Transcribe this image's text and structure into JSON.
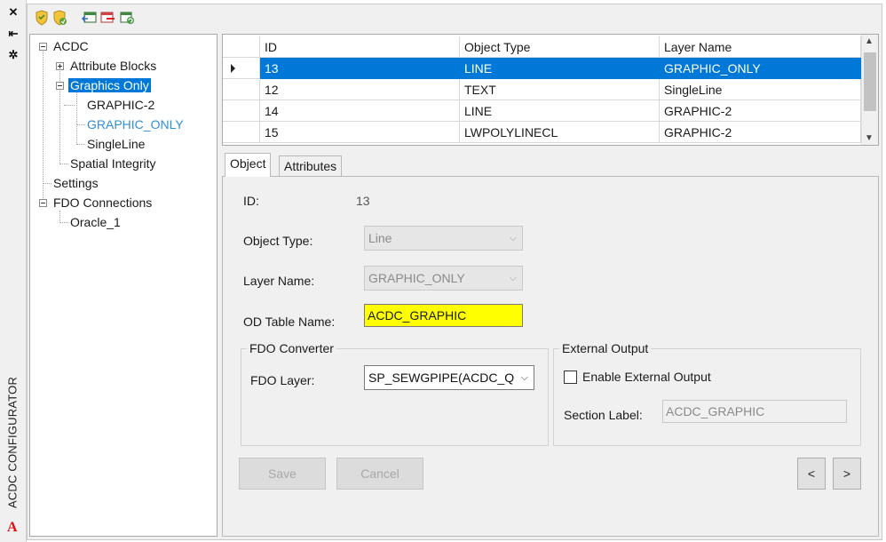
{
  "strip": {
    "title": "ACDC CONFIGURATOR",
    "icons": [
      "close-icon",
      "pin-icon",
      "settings-icon"
    ],
    "logo": "A"
  },
  "toolbar": {
    "icons": [
      "shield-icon",
      "shield-refresh-icon",
      "table-export-icon",
      "table-delete-icon",
      "refresh-icon"
    ]
  },
  "tree": {
    "items": [
      {
        "label": "ACDC"
      },
      {
        "label": "Attribute Blocks"
      },
      {
        "label": "Graphics Only"
      },
      {
        "label": "GRAPHIC-2"
      },
      {
        "label": "GRAPHIC_ONLY"
      },
      {
        "label": "SingleLine"
      },
      {
        "label": "Spatial Integrity"
      },
      {
        "label": "Settings"
      },
      {
        "label": "FDO Connections"
      },
      {
        "label": "Oracle_1"
      }
    ],
    "selected": "Graphics Only"
  },
  "grid": {
    "columns": [
      "ID",
      "Object Type",
      "Layer Name"
    ],
    "rows": [
      {
        "id": "13",
        "object_type": "LINE",
        "layer_name": "GRAPHIC_ONLY"
      },
      {
        "id": "12",
        "object_type": "TEXT",
        "layer_name": "SingleLine"
      },
      {
        "id": "14",
        "object_type": "LINE",
        "layer_name": "GRAPHIC-2"
      },
      {
        "id": "15",
        "object_type": "LWPOLYLINECL",
        "layer_name": "GRAPHIC-2"
      }
    ],
    "selected_row": 0
  },
  "tabs": {
    "object": "Object",
    "attributes": "Attributes",
    "active": "Object"
  },
  "form": {
    "id_label": "ID:",
    "id_value": "13",
    "object_type_label": "Object Type:",
    "object_type_value": "Line",
    "layer_name_label": "Layer Name:",
    "layer_name_value": "GRAPHIC_ONLY",
    "od_table_label": "OD Table Name:",
    "od_table_value": "ACDC_GRAPHIC",
    "od_table_highlight": "#ffff00",
    "fdo_group_title": "FDO Converter",
    "fdo_layer_label": "FDO Layer:",
    "fdo_layer_value": "SP_SEWGPIPE(ACDC_QA/",
    "external_group_title": "External Output",
    "enable_external_label": "Enable External Output",
    "enable_external_checked": false,
    "section_label_label": "Section Label:",
    "section_label_value": "ACDC_GRAPHIC"
  },
  "buttons": {
    "save": "Save",
    "cancel": "Cancel",
    "prev": "<",
    "next": ">"
  },
  "colors": {
    "selection": "#0078d7",
    "link": "#2e8fd9",
    "highlight_field": "#ffff00"
  }
}
